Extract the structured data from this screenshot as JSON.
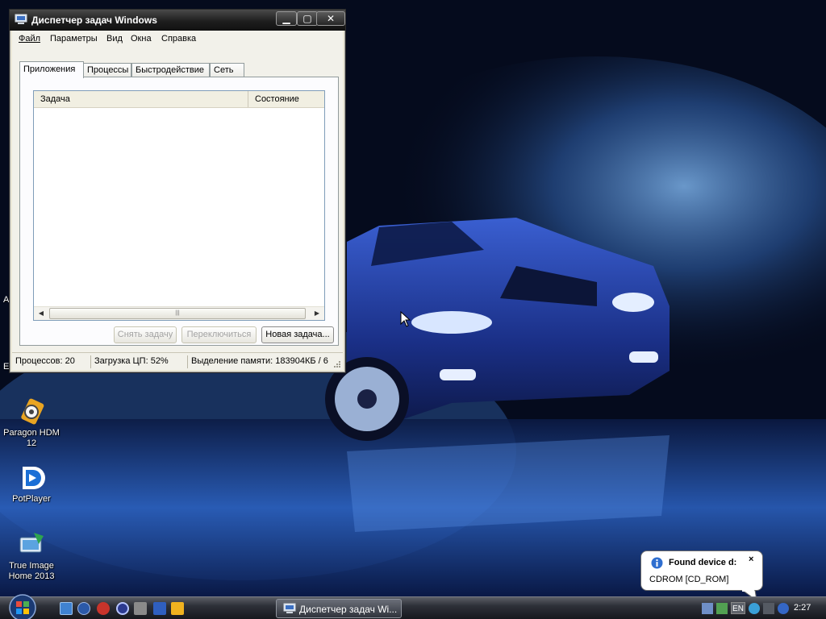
{
  "window": {
    "title": "Диспетчер задач Windows",
    "menu": [
      {
        "label": "Файл"
      },
      {
        "label": "Параметры"
      },
      {
        "label": "Вид"
      },
      {
        "label": "Окна"
      },
      {
        "label": "Справка"
      }
    ],
    "tabs": [
      {
        "label": "Приложения",
        "active": true
      },
      {
        "label": "Процессы",
        "active": false
      },
      {
        "label": "Быстродействие",
        "active": false
      },
      {
        "label": "Сеть",
        "active": false
      }
    ],
    "columns": [
      "Задача",
      "Состояние"
    ],
    "buttons": {
      "end_task": "Снять задачу",
      "switch_to": "Переключиться",
      "new_task": "Новая задача..."
    },
    "status": {
      "processes": "Процессов: 20",
      "cpu": "Загрузка ЦП: 52%",
      "memory": "Выделение памяти: 183904КБ / 6"
    }
  },
  "desktop": {
    "icons": [
      {
        "label": "Paragon HDM 12"
      },
      {
        "label": "PotPlayer"
      },
      {
        "label": "True Image Home 2013"
      }
    ],
    "edge_glyphs": [
      {
        "label": "А"
      },
      {
        "label": "Е"
      }
    ]
  },
  "taskbar": {
    "task_button": "Диспетчер задач Wi...",
    "language": "EN",
    "clock": "2:27"
  },
  "balloon": {
    "title": "Found device d:",
    "text": "CDROM   [CD_ROM]",
    "close": "×"
  },
  "colors": {
    "wallpaper_dark": "#050b1d",
    "wallpaper_blue": "#1f3f99",
    "titlebar": "#1e1e1e",
    "window_face": "#ece9d8"
  }
}
